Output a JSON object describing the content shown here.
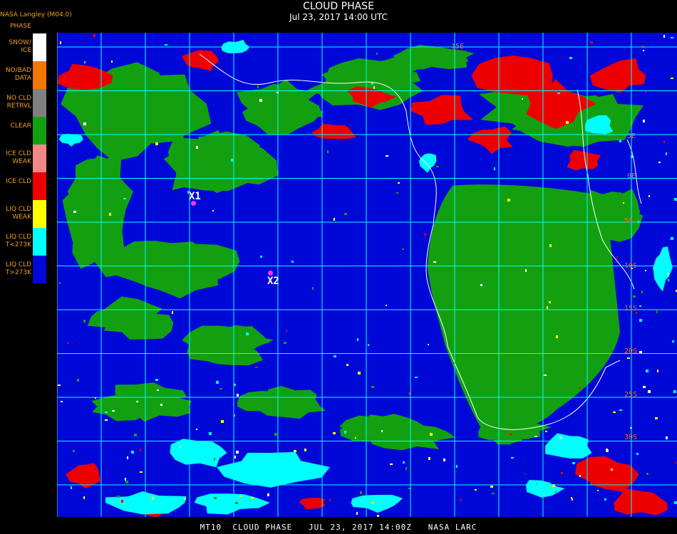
{
  "header": {
    "title": "CLOUD PHASE",
    "subtitle": "Jul 23, 2017 14:00 UTC",
    "org": "NASA Langley (M04.0)",
    "legend_heading": "PHASE"
  },
  "legend": [
    {
      "label": "SNOW/\nICE",
      "color": "#ffffff"
    },
    {
      "label": "NO/BAD\nDATA",
      "color": "#f07800"
    },
    {
      "label": "NO CLD\nRETRVL",
      "color": "#808080"
    },
    {
      "label": "CLEAR",
      "color": "#13a010"
    },
    {
      "label": "ICE CLD\nWEAK",
      "color": "#f08888"
    },
    {
      "label": "ICE CLD",
      "color": "#ee0000"
    },
    {
      "label": "LIQ CLD\nWEAK",
      "color": "#ffff00"
    },
    {
      "label": "LIQ CLD\nT<273K",
      "color": "#00ffff"
    },
    {
      "label": "LIQ CLD\nT>273K",
      "color": "#0008d8"
    }
  ],
  "markers": [
    {
      "label": "X1"
    },
    {
      "label": "X2"
    }
  ],
  "grid_labels": [
    "15E",
    "5E",
    "0E",
    "5S",
    "10S",
    "15S",
    "20S",
    "25S",
    "30S",
    "35S"
  ],
  "footer": "MT10  CLOUD PHASE   JUL 23, 2017 14:00Z   NASA LARC"
}
